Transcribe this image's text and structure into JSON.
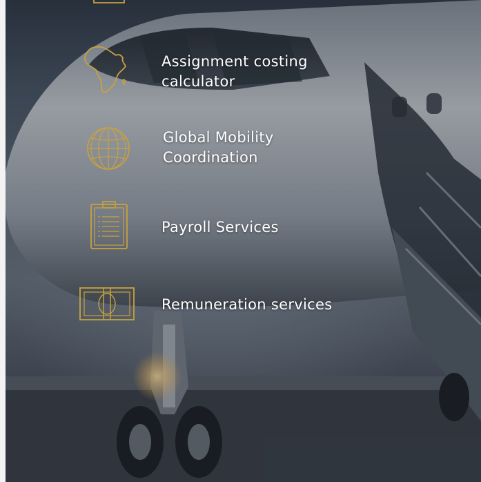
{
  "services": [
    {
      "label": "Assignment costing calculator",
      "icon": "africa-map-icon"
    },
    {
      "label": "Global Mobility Coordination",
      "icon": "globe-icon"
    },
    {
      "label": "Payroll Services",
      "icon": "clipboard-icon"
    },
    {
      "label": "Remuneration services",
      "icon": "banknote-icon"
    }
  ],
  "colors": {
    "icon_gold": "#c9a23c",
    "label_text": "#ffffff"
  }
}
